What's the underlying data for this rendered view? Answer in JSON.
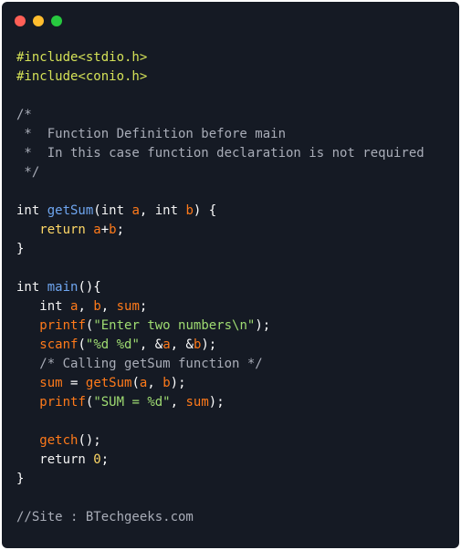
{
  "window": {
    "buttons": [
      {
        "name": "close",
        "color": "#ff5f56"
      },
      {
        "name": "minimize",
        "color": "#ffbd2e"
      },
      {
        "name": "maximize",
        "color": "#27c93f"
      }
    ]
  },
  "code": {
    "lines": [
      [
        {
          "t": "#include<stdio.h>",
          "c": "pre"
        }
      ],
      [
        {
          "t": "#include<conio.h>",
          "c": "pre"
        }
      ],
      [],
      [
        {
          "t": "/*",
          "c": "comment"
        }
      ],
      [
        {
          "t": " *  Function Definition before main",
          "c": "comment"
        }
      ],
      [
        {
          "t": " *  In this case function declaration is not required",
          "c": "comment"
        }
      ],
      [
        {
          "t": " */",
          "c": "comment"
        }
      ],
      [],
      [
        {
          "t": "int ",
          "c": "kw"
        },
        {
          "t": "getSum",
          "c": "fn"
        },
        {
          "t": "(",
          "c": "plain"
        },
        {
          "t": "int ",
          "c": "kw"
        },
        {
          "t": "a",
          "c": "param"
        },
        {
          "t": ", ",
          "c": "plain"
        },
        {
          "t": "int ",
          "c": "kw"
        },
        {
          "t": "b",
          "c": "param"
        },
        {
          "t": ") {",
          "c": "plain"
        }
      ],
      [
        {
          "t": "   return ",
          "c": "num"
        },
        {
          "t": "a",
          "c": "param"
        },
        {
          "t": "+",
          "c": "plain"
        },
        {
          "t": "b",
          "c": "param"
        },
        {
          "t": ";",
          "c": "plain"
        }
      ],
      [
        {
          "t": "}",
          "c": "plain"
        }
      ],
      [],
      [
        {
          "t": "int ",
          "c": "kw"
        },
        {
          "t": "main",
          "c": "fn"
        },
        {
          "t": "(){",
          "c": "plain"
        }
      ],
      [
        {
          "t": "   int ",
          "c": "kw"
        },
        {
          "t": "a",
          "c": "param"
        },
        {
          "t": ", ",
          "c": "plain"
        },
        {
          "t": "b",
          "c": "param"
        },
        {
          "t": ", ",
          "c": "plain"
        },
        {
          "t": "sum",
          "c": "param"
        },
        {
          "t": ";",
          "c": "plain"
        }
      ],
      [
        {
          "t": "   ",
          "c": "plain"
        },
        {
          "t": "printf",
          "c": "call"
        },
        {
          "t": "(",
          "c": "plain"
        },
        {
          "t": "\"Enter two numbers\\n\"",
          "c": "str"
        },
        {
          "t": ");",
          "c": "plain"
        }
      ],
      [
        {
          "t": "   ",
          "c": "plain"
        },
        {
          "t": "scanf",
          "c": "call"
        },
        {
          "t": "(",
          "c": "plain"
        },
        {
          "t": "\"%d %d\"",
          "c": "str"
        },
        {
          "t": ", &",
          "c": "plain"
        },
        {
          "t": "a",
          "c": "param"
        },
        {
          "t": ", &",
          "c": "plain"
        },
        {
          "t": "b",
          "c": "param"
        },
        {
          "t": ");",
          "c": "plain"
        }
      ],
      [
        {
          "t": "   /* Calling getSum function */",
          "c": "comment"
        }
      ],
      [
        {
          "t": "   ",
          "c": "plain"
        },
        {
          "t": "sum",
          "c": "param"
        },
        {
          "t": " = ",
          "c": "plain"
        },
        {
          "t": "getSum",
          "c": "call"
        },
        {
          "t": "(",
          "c": "plain"
        },
        {
          "t": "a",
          "c": "param"
        },
        {
          "t": ", ",
          "c": "plain"
        },
        {
          "t": "b",
          "c": "param"
        },
        {
          "t": ");",
          "c": "plain"
        }
      ],
      [
        {
          "t": "   ",
          "c": "plain"
        },
        {
          "t": "printf",
          "c": "call"
        },
        {
          "t": "(",
          "c": "plain"
        },
        {
          "t": "\"SUM = %d\"",
          "c": "str"
        },
        {
          "t": ", ",
          "c": "plain"
        },
        {
          "t": "sum",
          "c": "param"
        },
        {
          "t": ");",
          "c": "plain"
        }
      ],
      [],
      [
        {
          "t": "   ",
          "c": "plain"
        },
        {
          "t": "getch",
          "c": "call"
        },
        {
          "t": "();",
          "c": "plain"
        }
      ],
      [
        {
          "t": "   return ",
          "c": "kw"
        },
        {
          "t": "0",
          "c": "num"
        },
        {
          "t": ";",
          "c": "plain"
        }
      ],
      [
        {
          "t": "}",
          "c": "plain"
        }
      ],
      [],
      [
        {
          "t": "//Site : BTechgeeks.com",
          "c": "comment"
        }
      ]
    ]
  }
}
